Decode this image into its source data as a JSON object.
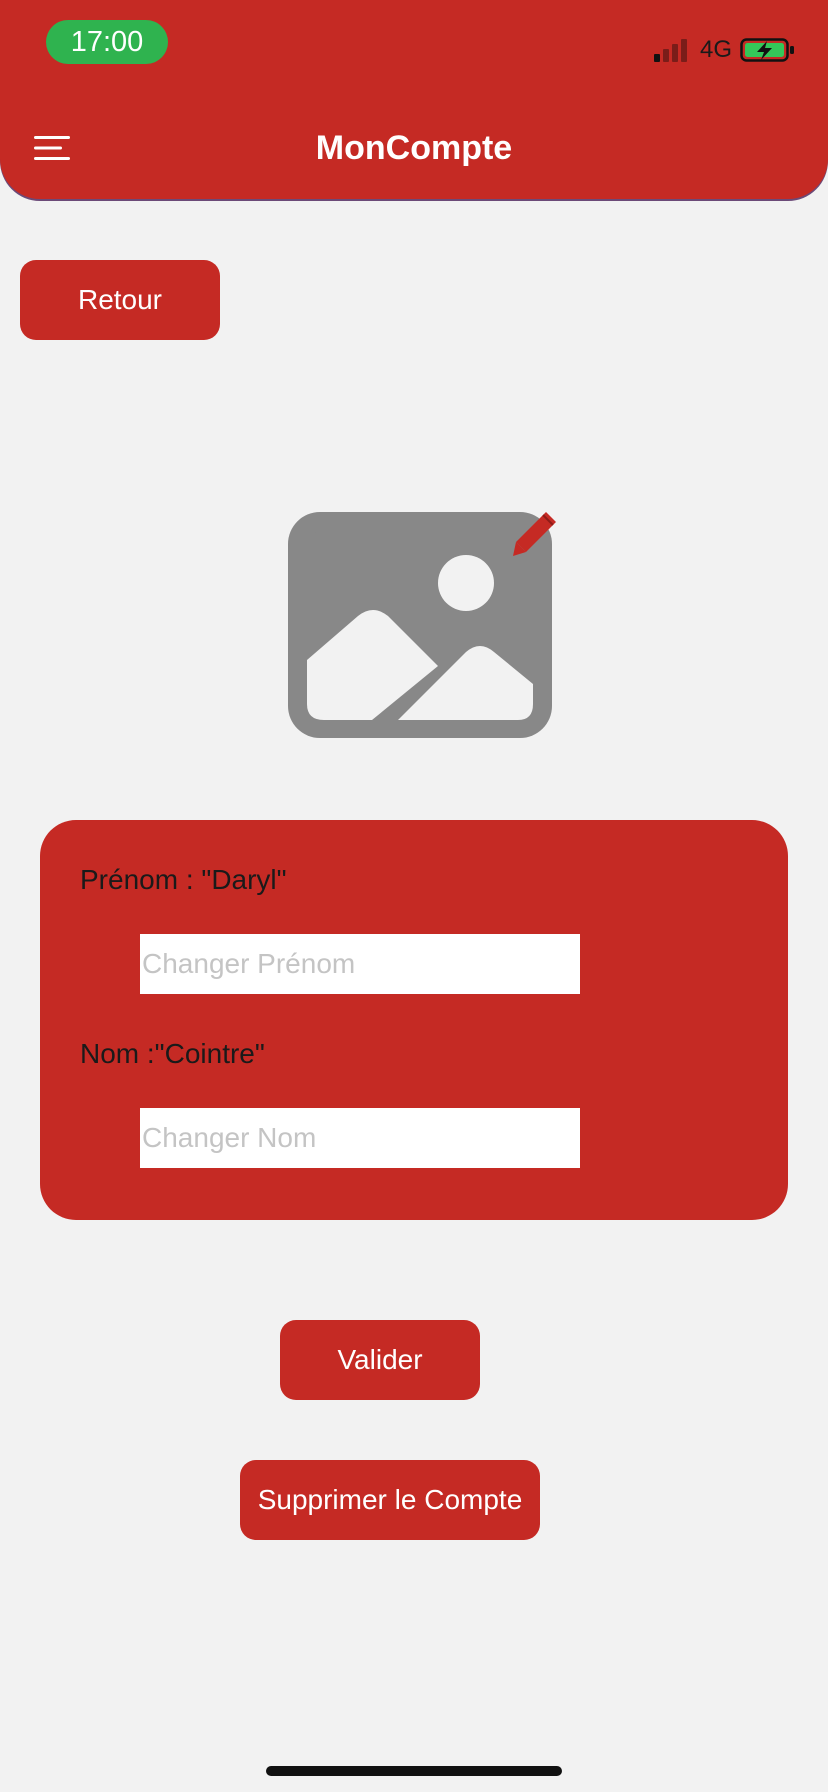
{
  "status_bar": {
    "time": "17:00",
    "network": "4G",
    "time_pill_color": "#2fb34f",
    "battery_state": "charging"
  },
  "header": {
    "title": "MonCompte",
    "menu_icon": "hamburger-menu-icon",
    "background_color": "#c52a24"
  },
  "actions": {
    "back_label": "Retour",
    "validate_label": "Valider",
    "delete_label": "Supprimer le Compte",
    "accent_color": "#c52a24"
  },
  "profile": {
    "photo_icon": "image-placeholder-icon",
    "edit_icon": "pencil-icon"
  },
  "form": {
    "firstname_label": "Prénom : \"Daryl\"",
    "firstname_placeholder": "Changer Prénom",
    "firstname_value": "",
    "lastname_label": "Nom :\"Cointre\"",
    "lastname_placeholder": "Changer Nom",
    "lastname_value": ""
  }
}
